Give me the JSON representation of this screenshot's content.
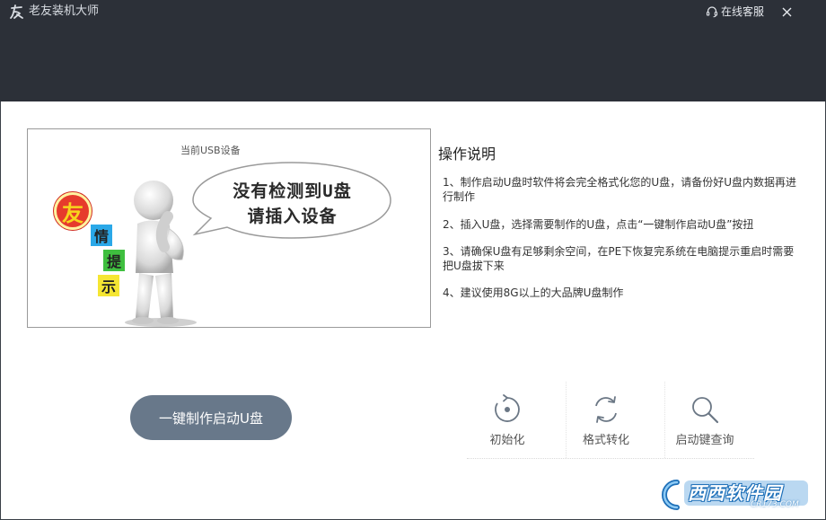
{
  "app": {
    "title": "老友装机大师",
    "online_service": "在线客服"
  },
  "usb_panel": {
    "title": "当前USB设备",
    "bubble_line1": "没有检测到U盘",
    "bubble_line2": "请插入设备",
    "badge_char": "友",
    "tip_chars": [
      "情",
      "提",
      "示"
    ]
  },
  "instructions": {
    "title": "操作说明",
    "items": [
      "1、制作启动U盘时软件将会完全格式化您的U盘，请备份好U盘内数据再进行制作",
      "2、插入U盘，选择需要制作的U盘，点击“一键制作启动U盘”按扭",
      "3、请确保U盘有足够剩余空间，在PE下恢复完系统在电脑提示重启时需要把U盘拔下来",
      "4、建议使用8G以上的大品牌U盘制作"
    ]
  },
  "main_button": "一键制作启动U盘",
  "tools": {
    "init": "初始化",
    "format": "格式转化",
    "query": "启动键查询"
  },
  "watermark": {
    "text": "西西软件园",
    "url": "CR173.COM"
  },
  "colors": {
    "header_bg": "#2c3038",
    "button_bg": "#68788a",
    "badge_red": "#e63b2c"
  }
}
